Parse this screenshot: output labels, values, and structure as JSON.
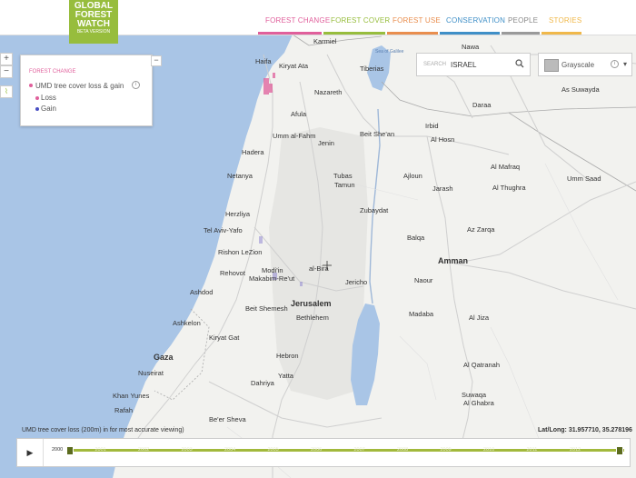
{
  "logo": {
    "line1": "GLOBAL",
    "line2": "FOREST",
    "line3": "WATCH",
    "tag": "BETA VERSION"
  },
  "nav": {
    "items": [
      {
        "label": "FOREST CHANGE",
        "color": "#e05f9b",
        "active": true
      },
      {
        "label": "FOREST COVER",
        "color": "#97bd3d",
        "active": false
      },
      {
        "label": "FOREST USE",
        "color": "#e98e4e",
        "active": false
      },
      {
        "label": "CONSERVATION",
        "color": "#3f8fc7",
        "active": false
      },
      {
        "label": "PEOPLE",
        "color": "#8a8a8a",
        "active": false
      },
      {
        "label": "STORIES",
        "color": "#f0b84a",
        "active": false
      }
    ]
  },
  "zoom": {
    "in": "+",
    "out": "−"
  },
  "layer_panel": {
    "title": "FOREST CHANGE",
    "layer_name": "UMD tree cover loss & gain",
    "info": "i",
    "legend": [
      {
        "label": "Loss",
        "color": "#e05f9b"
      },
      {
        "label": "Gain",
        "color": "#4a4fc4"
      }
    ],
    "collapse": "−"
  },
  "search": {
    "label": "SEARCH",
    "value": "ISRAEL",
    "icon": "search-icon"
  },
  "basemap": {
    "label": "Grayscale",
    "info": "i",
    "caret": "▾"
  },
  "footer": {
    "layer_note": "UMD tree cover loss (200m) in for most accurate viewing)",
    "latlong": "Lat/Long: 31.957710, 35.278196"
  },
  "timeline": {
    "play": "▶",
    "years": [
      "2000",
      "2001",
      "2002",
      "2003",
      "2004",
      "2005",
      "2006",
      "2007",
      "2008",
      "2009",
      "2010",
      "2011",
      "2012"
    ],
    "track_color": "#a2b93c"
  },
  "map": {
    "places": [
      "Haifa",
      "Karmiel",
      "Kiryat Ata",
      "Nazareth",
      "Tiberias",
      "Sea of Galilee",
      "Afula",
      "Hadera",
      "Umm al-Fahm",
      "Jenin",
      "Beit She'an",
      "Netanya",
      "Tubas",
      "Tamun",
      "Zubaydat",
      "Herzliya",
      "Tel Aviv-Yafo",
      "Rishon LeZion",
      "Rehovot",
      "Modi'in",
      "Makabim-Re'ut",
      "al-Bira",
      "Ashdod",
      "Jericho",
      "Jerusalem",
      "Beit Shemesh",
      "Bethlehem",
      "Ashkelon",
      "Kiryat Gat",
      "Gaza",
      "Hebron",
      "Yatta",
      "Dahriya",
      "Nuseirat",
      "Khan Yunes",
      "Rafah",
      "Be'er Sheva",
      "Nawa",
      "Daraa",
      "Irbid",
      "Al Hosn",
      "Ajloun",
      "Jarash",
      "Al Mafraq",
      "Balqa",
      "Az Zarqa",
      "Amman",
      "Naour",
      "Madaba",
      "Al Jiza",
      "Al Qatranah",
      "Suwaqa",
      "Al Ghabra",
      "As Suwayda",
      "Al Thughra",
      "Umm Saad"
    ]
  }
}
